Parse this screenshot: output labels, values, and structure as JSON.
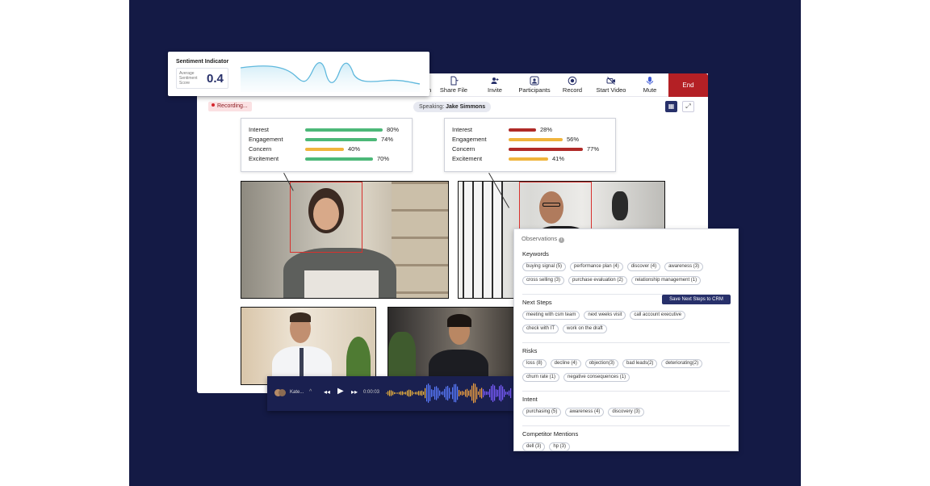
{
  "toolbar": {
    "partial_label": "n",
    "items": [
      {
        "label": "Share File",
        "icon": "share-file-icon"
      },
      {
        "label": "Invite",
        "icon": "invite-icon"
      },
      {
        "label": "Participants",
        "icon": "participants-icon"
      },
      {
        "label": "Record",
        "icon": "record-icon"
      },
      {
        "label": "Start Video",
        "icon": "video-off-icon"
      },
      {
        "label": "Mute",
        "icon": "microphone-icon"
      }
    ],
    "end_label": "End",
    "end_color": "#b42025"
  },
  "status": {
    "recording": "Recording...",
    "speaking_prefix": "Speaking:",
    "speaking_name": "Jake Simmons"
  },
  "sentiment": {
    "title": "Sentiment Indicator",
    "label": "Average Sentiment Score",
    "value": "0.4"
  },
  "metrics_left": [
    {
      "label": "Interest",
      "value": "80%",
      "pct": 80,
      "color": "#4cb878"
    },
    {
      "label": "Engagement",
      "value": "74%",
      "pct": 74,
      "color": "#4cb878"
    },
    {
      "label": "Concern",
      "value": "40%",
      "pct": 40,
      "color": "#f0b43c"
    },
    {
      "label": "Excitement",
      "value": "70%",
      "pct": 70,
      "color": "#4cb878"
    }
  ],
  "metrics_right": [
    {
      "label": "Interest",
      "value": "28%",
      "pct": 28,
      "color": "#b02a27"
    },
    {
      "label": "Engagement",
      "value": "56%",
      "pct": 56,
      "color": "#f0b43c"
    },
    {
      "label": "Concern",
      "value": "77%",
      "pct": 77,
      "color": "#b02a27"
    },
    {
      "label": "Excitement",
      "value": "41%",
      "pct": 41,
      "color": "#f0b43c"
    }
  ],
  "observations": {
    "title": "Observations",
    "crm_button": "Save Next Steps to CRM",
    "sections": [
      {
        "title": "Keywords",
        "rows": [
          [
            "buying signal (5)",
            "performance plan (4)",
            "discover (4)",
            "awareness (3)"
          ],
          [
            "cross selling (3)",
            "purchase evaluation (2)",
            "relationship management (1)"
          ]
        ]
      },
      {
        "title": "Next Steps",
        "rows": [
          [
            "meeting with csm team",
            "next weeks visit",
            "call account executive"
          ],
          [
            "check with IT",
            "work on the draft"
          ]
        ]
      },
      {
        "title": "Risks",
        "rows": [
          [
            "loss (8)",
            "decline (4)",
            "objection(3)",
            "bad leads(2)",
            "deteriorating(2)"
          ],
          [
            "churn rate (1)",
            "negative consequences (1)"
          ]
        ]
      },
      {
        "title": "Intent",
        "rows": [
          [
            "purchasing (5)",
            "awareness (4)",
            "discovery (3)"
          ]
        ]
      },
      {
        "title": "Competitor Mentions",
        "rows": [
          [
            "dell (3)",
            "hp (3)"
          ]
        ]
      }
    ]
  },
  "audio": {
    "speaker": "Kate...",
    "time": "0:00:03"
  }
}
